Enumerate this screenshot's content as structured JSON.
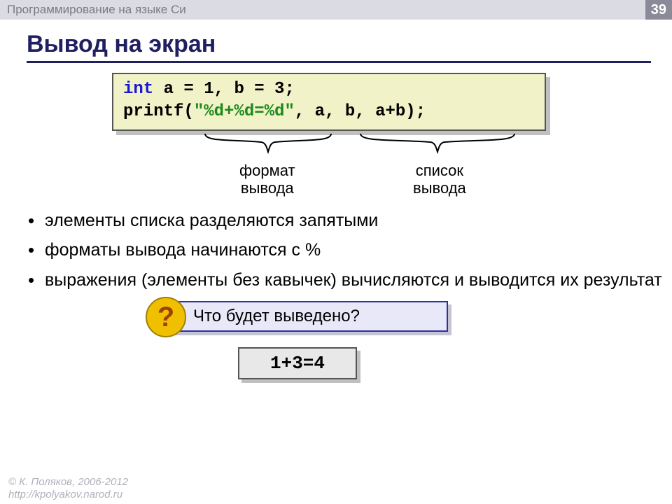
{
  "header": {
    "title": "Программирование на языке Си",
    "page": "39"
  },
  "slide_title": "Вывод на экран",
  "code": {
    "line1_int": "int",
    "line1_rest": " a = 1, b = 3;",
    "line2_pre": "printf(",
    "line2_str": "\"%d+%d=%d\"",
    "line2_post": ", a, b, a+b);"
  },
  "annotations": {
    "format1": "формат",
    "format2": "вывода",
    "list1": "список",
    "list2": "вывода"
  },
  "bullets": [
    "элементы списка разделяются запятыми",
    "форматы вывода начинаются с %",
    "выражения (элементы без кавычек) вычисляются и выводится их результат"
  ],
  "question": "Что будет выведено?",
  "answer": "1+3=4",
  "footer": {
    "copyright": "© К. Поляков, 2006-2012",
    "url": "http://kpolyakov.narod.ru"
  }
}
